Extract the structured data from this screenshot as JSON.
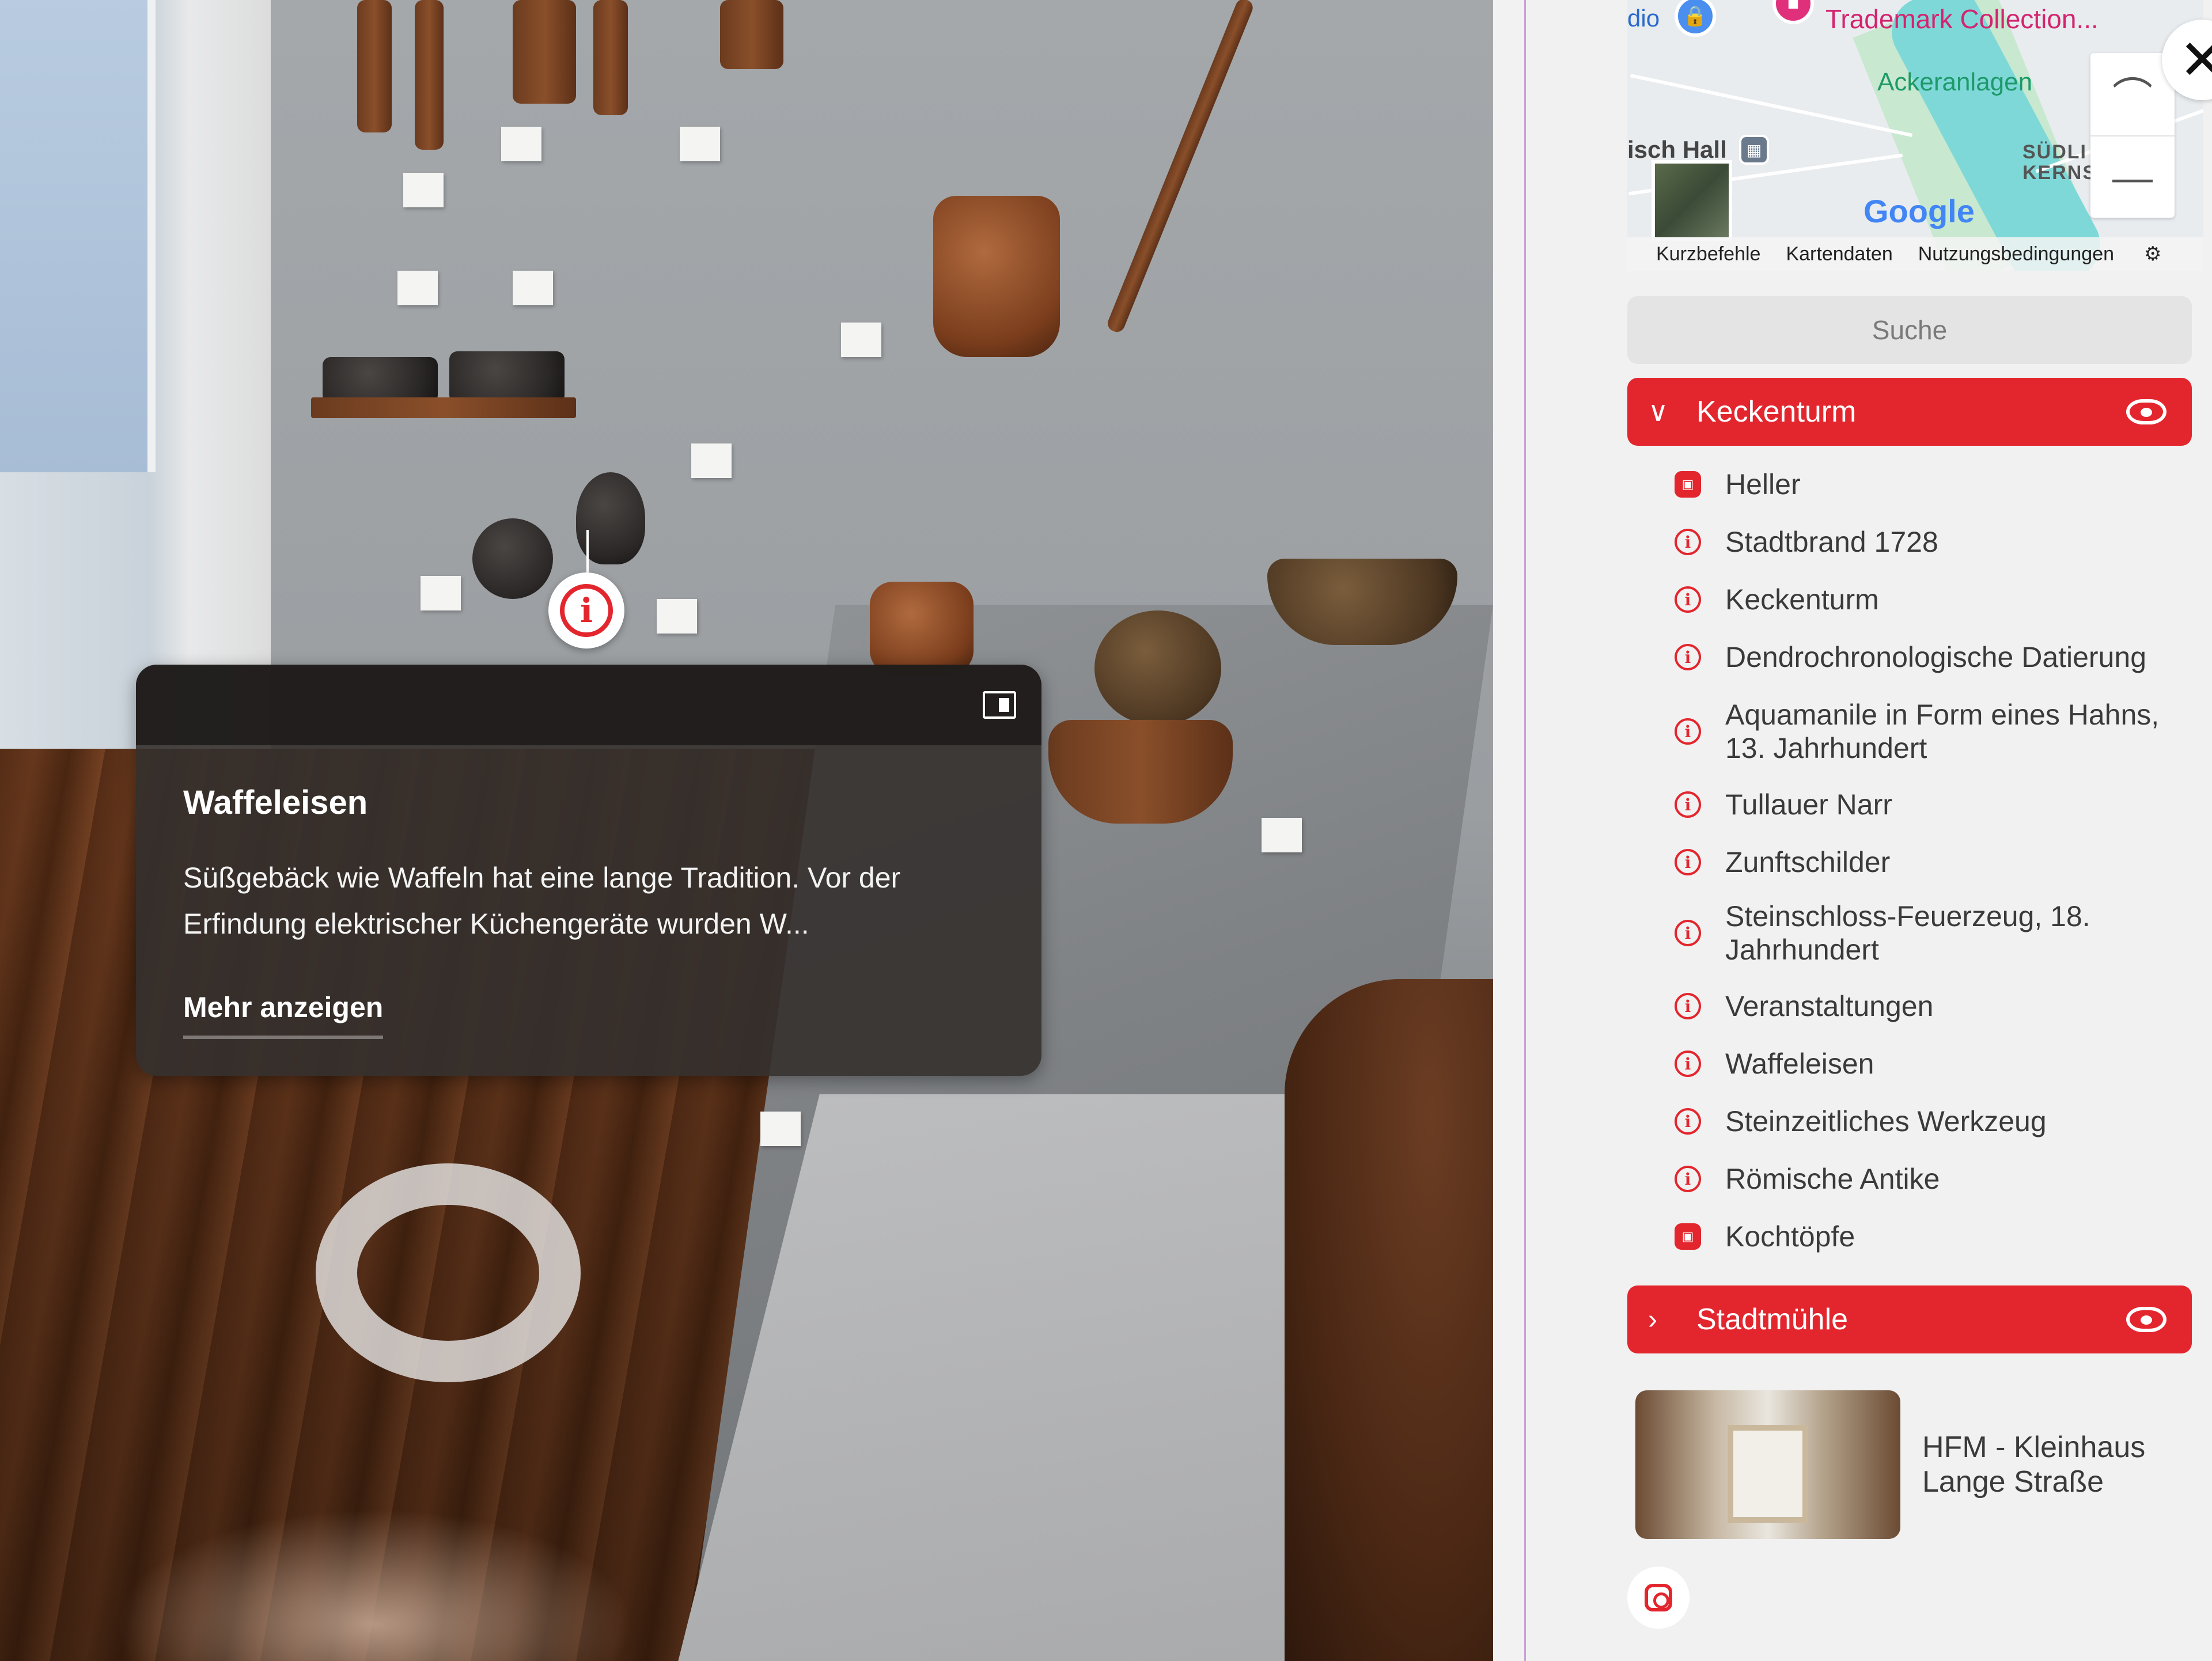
{
  "tooltip": {
    "title": "Waffeleisen",
    "body": "Süßgebäck wie Waffeln hat eine lange Tradition. Vor der Erfindung elektrischer Küchengeräte wurden W...",
    "more_label": "Mehr anzeigen"
  },
  "map": {
    "labels": {
      "studio": "dio",
      "hotel": "Trademark Collection...",
      "park": "Ackeranlagen",
      "station": "isch Hall",
      "district": "SÜDLI KERNS",
      "google": "Google"
    },
    "attribution": {
      "shortcuts": "Kurzbefehle",
      "mapdata": "Kartendaten",
      "terms": "Nutzungsbedingungen"
    }
  },
  "panel": {
    "search_label": "Suche",
    "groups": [
      {
        "title": "Keckenturm",
        "expanded": true
      },
      {
        "title": "Stadtmühle",
        "expanded": false
      }
    ],
    "items": [
      {
        "label": "Heller",
        "icon": "media-icon"
      },
      {
        "label": "Stadtbrand 1728",
        "icon": "info-icon"
      },
      {
        "label": "Keckenturm",
        "icon": "info-icon"
      },
      {
        "label": "Dendrochronologische Datierung",
        "icon": "info-icon"
      },
      {
        "label": "Aquamanile in Form eines Hahns, 13. Jahrhundert",
        "icon": "info-icon"
      },
      {
        "label": "Tullauer Narr",
        "icon": "info-icon"
      },
      {
        "label": "Zunftschilder",
        "icon": "info-icon"
      },
      {
        "label": "Steinschloss-Feuerzeug, 18. Jahrhundert",
        "icon": "info-icon"
      },
      {
        "label": "Veranstaltungen",
        "icon": "info-icon"
      },
      {
        "label": "Waffeleisen",
        "icon": "info-icon"
      },
      {
        "label": "Steinzeitliches Werkzeug",
        "icon": "info-icon"
      },
      {
        "label": "Römische Antike",
        "icon": "info-icon"
      },
      {
        "label": "Kochtöpfe",
        "icon": "media-icon"
      }
    ],
    "tour": {
      "name": "HFM - Kleinhaus Lange Straße"
    }
  },
  "colors": {
    "accent": "#e3262e",
    "panel_bg": "#f1f1f1"
  }
}
